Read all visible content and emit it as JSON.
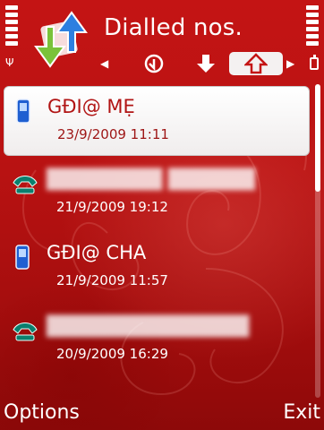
{
  "header": {
    "title": "Dialled nos.",
    "icons": {
      "app": "call-log-arrows-icon",
      "received_tab": "received-calls-icon",
      "missed_tab": "missed-calls-icon",
      "dialled_tab": "dialled-calls-icon"
    }
  },
  "status": {
    "signal_icon": "antenna-icon",
    "battery_icon": "battery-icon"
  },
  "list": {
    "items": [
      {
        "name": "GĐI@ MẸ",
        "datetime": "23/9/2009 11:11",
        "icon": "mobile-phone-icon",
        "selected": true
      },
      {
        "name": "",
        "datetime": "21/9/2009 19:12",
        "icon": "landline-phone-icon",
        "selected": false
      },
      {
        "name": "GĐI@ CHA",
        "datetime": "21/9/2009 11:57",
        "icon": "mobile-phone-icon",
        "selected": false
      },
      {
        "name": "",
        "datetime": "20/9/2009 16:29",
        "icon": "landline-phone-icon",
        "selected": false
      }
    ]
  },
  "softkeys": {
    "left": "Options",
    "right": "Exit"
  },
  "colors": {
    "background": "#b81212",
    "selected_text": "#b11414",
    "phone_icon": "#1f5fd1",
    "landline_icon": "#0a7f6e"
  }
}
